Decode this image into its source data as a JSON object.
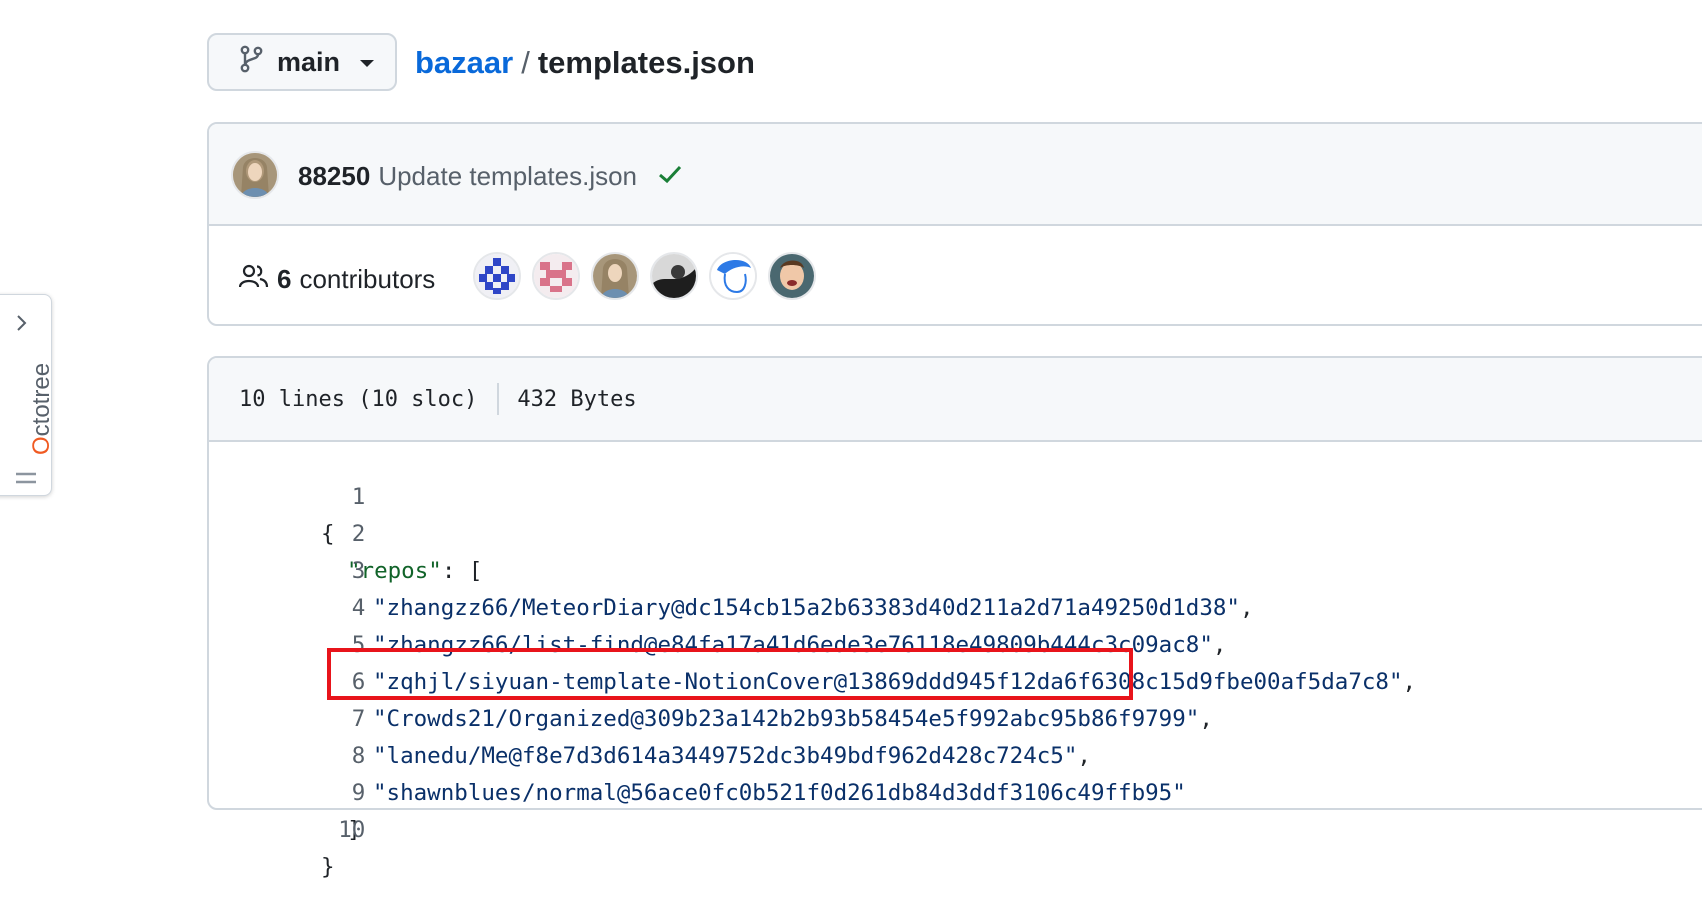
{
  "branch": {
    "label": "main",
    "icon": "git-branch-icon"
  },
  "breadcrumb": {
    "repo": "bazaar",
    "separator": "/",
    "file": "templates.json"
  },
  "commit": {
    "author": "88250",
    "message": "Update templates.json",
    "status_icon": "check-icon",
    "status_color": "#1a7f37"
  },
  "contributors": {
    "count": "6",
    "label": "contributors",
    "icon": "people-icon"
  },
  "file_info": {
    "lines": "10 lines (10 sloc)",
    "size": "432 Bytes"
  },
  "code": {
    "line_numbers": [
      "1",
      "2",
      "3",
      "4",
      "5",
      "6",
      "7",
      "8",
      "9",
      "10"
    ],
    "line1": "{",
    "line2_key": "\"repos\"",
    "line2_rest": ": [",
    "line3": "\"zhangzz66/MeteorDiary@dc154cb15a2b63383d40d211a2d71a49250d1d38\"",
    "line4": "\"zhangzz66/list-find@e84fa17a41d6ede3e76118e49809b444c3c09ac8\"",
    "line5": "\"zqhjl/siyuan-template-NotionCover@13869ddd945f12da6f6308c15d9fbe00af5da7c8\"",
    "line6": "\"Crowds21/Organized@309b23a142b2b93b58454e5f992abc95b86f9799\"",
    "line7": "\"lanedu/Me@f8e7d3d614a3449752dc3b49bdf962d428c724c5\"",
    "line8": "\"shawnblues/normal@56ace0fc0b521f0d261db84d3ddf3106c49ffb95\"",
    "line9": "]",
    "line10": "}",
    "comma": ","
  },
  "sidebar": {
    "octotree_first": "O",
    "octotree_rest": "ctotree",
    "accent": "#f05a22"
  },
  "colors": {
    "link": "#0969da",
    "highlight": "#e8141b"
  }
}
